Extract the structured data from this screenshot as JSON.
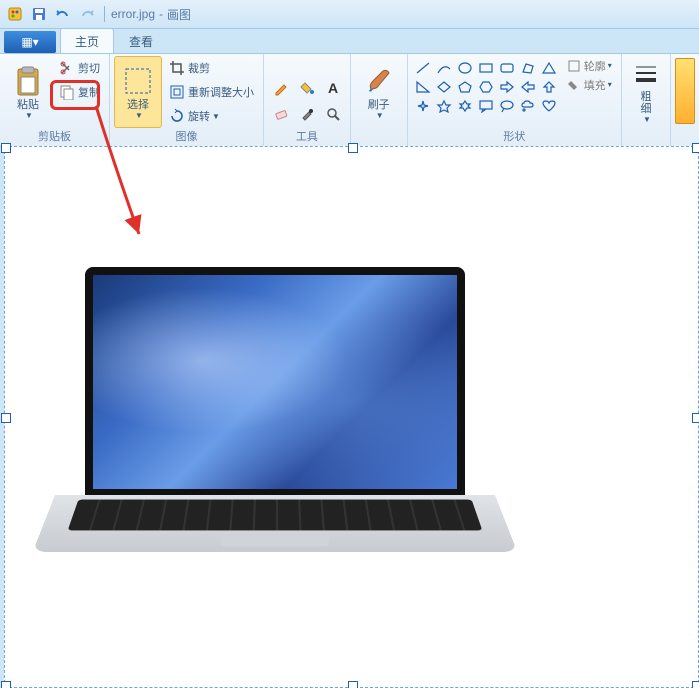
{
  "title": {
    "filename": "error.jpg",
    "sep": "-",
    "appname": "画图"
  },
  "file_menu": "▦▾",
  "tabs": {
    "home": "主页",
    "view": "查看"
  },
  "clipboard": {
    "group_label": "剪贴板",
    "paste": "粘贴",
    "cut": "剪切",
    "copy": "复制"
  },
  "image": {
    "group_label": "图像",
    "select": "选择",
    "crop": "裁剪",
    "resize": "重新调整大小",
    "rotate": "旋转"
  },
  "tools": {
    "group_label": "工具"
  },
  "brush": {
    "label": "刷子"
  },
  "shapes": {
    "group_label": "形状",
    "outline": "轮廓",
    "fill": "填充"
  },
  "stroke": {
    "thick": "粗",
    "thin": "细"
  }
}
